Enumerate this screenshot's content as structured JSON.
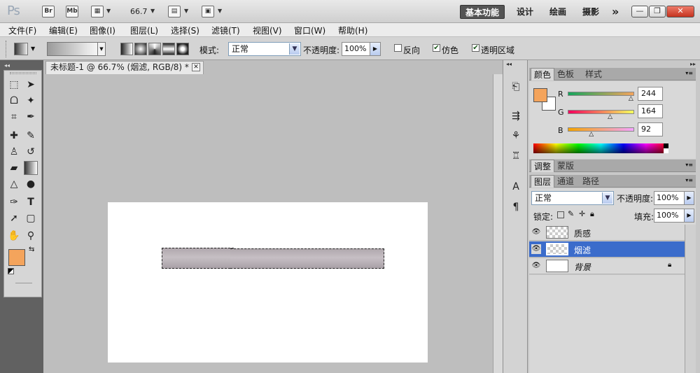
{
  "app": {
    "logo": "Ps",
    "bridge_icon": "Br",
    "minibridge_icon": "Mb",
    "zoom": "66.7",
    "workspaces": [
      "基本功能",
      "设计",
      "绘画",
      "摄影"
    ],
    "more_workspaces": "»"
  },
  "menu": {
    "items": [
      "文件(F)",
      "编辑(E)",
      "图像(I)",
      "图层(L)",
      "选择(S)",
      "滤镜(T)",
      "视图(V)",
      "窗口(W)",
      "帮助(H)"
    ]
  },
  "options": {
    "mode_label": "模式:",
    "mode_value": "正常",
    "opacity_label": "不透明度:",
    "opacity_value": "100%",
    "reverse_label": "反向",
    "dither_label": "仿色",
    "transparency_label": "透明区域"
  },
  "document": {
    "tab_title": "未标题-1 @ 66.7% (烟滤, RGB/8) *"
  },
  "color_panel": {
    "tabs": [
      "颜色",
      "色板",
      "样式"
    ],
    "r_label": "R",
    "r_value": "244",
    "r_fraction": 0.957,
    "g_label": "G",
    "g_value": "164",
    "g_fraction": 0.643,
    "b_label": "B",
    "b_value": "92",
    "b_fraction": 0.361,
    "foreground": "#f4a45c",
    "background": "#ffffff"
  },
  "adjust_panel": {
    "tabs": [
      "调整",
      "蒙版"
    ]
  },
  "layers_panel": {
    "tabs": [
      "图层",
      "通道",
      "路径"
    ],
    "blend_mode": "正常",
    "opacity_label": "不透明度:",
    "opacity_value": "100%",
    "lock_label": "锁定:",
    "fill_label": "填充:",
    "fill_value": "100%",
    "layers": [
      {
        "name": "质感",
        "selected": false
      },
      {
        "name": "烟滤",
        "selected": true
      },
      {
        "name": "背景",
        "selected": false
      }
    ]
  },
  "colors": {
    "selection": "#3b6ccb",
    "foreground_swatch": "#f4a45c"
  }
}
